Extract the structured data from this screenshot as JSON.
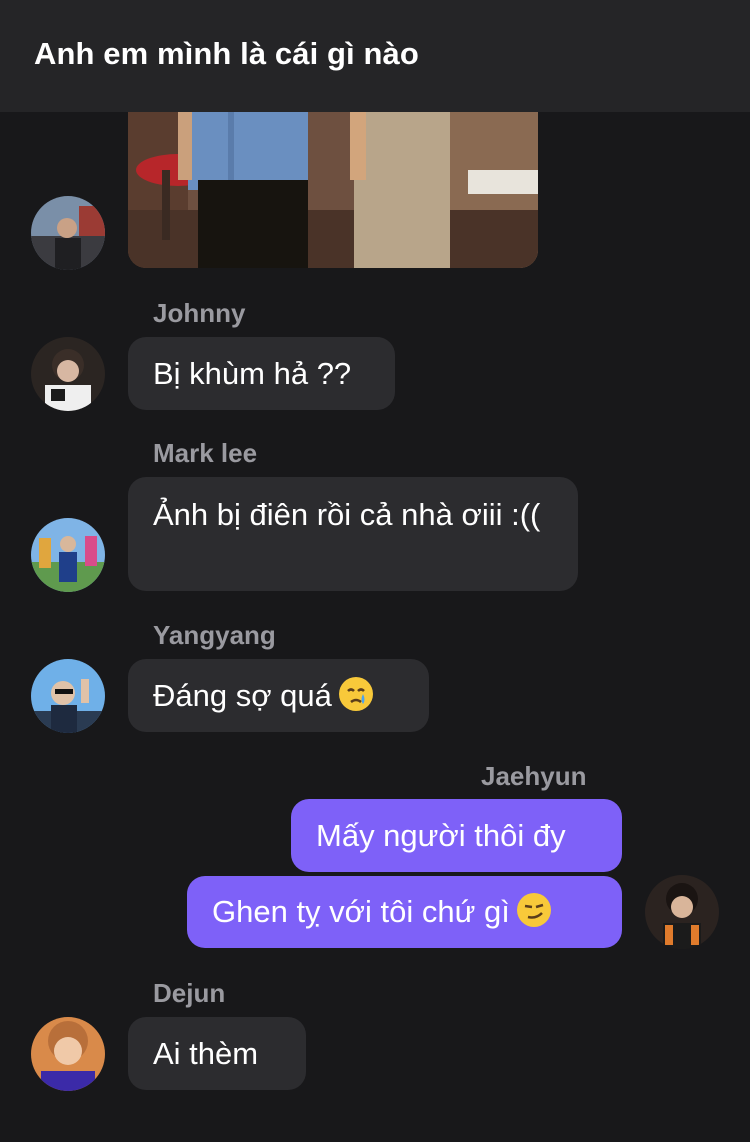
{
  "header": {
    "title": "Anh em mình là cái gì nào"
  },
  "messages": [
    {
      "sender": "Johnny",
      "text": "Bị khùm hả ??"
    },
    {
      "sender": "Mark lee",
      "text": "Ảnh bị điên rồi cả nhà ơiii :(("
    },
    {
      "sender": "Yangyang",
      "text": "Đáng sợ quá",
      "emoji": "crying-face-emoji"
    },
    {
      "sender": "Jaehyun",
      "text_1": "Mấy người thôi đy",
      "text_2": "Ghen tỵ với tôi chứ gì",
      "emoji": "smirking-face-emoji"
    },
    {
      "sender": "Dejun",
      "text": "Ai thèm"
    }
  ],
  "colors": {
    "background": "#18181a",
    "header": "#252527",
    "bubble_incoming": "#2c2c2f",
    "bubble_outgoing": "#7e61f8",
    "sender_name": "#9a9aa0"
  }
}
